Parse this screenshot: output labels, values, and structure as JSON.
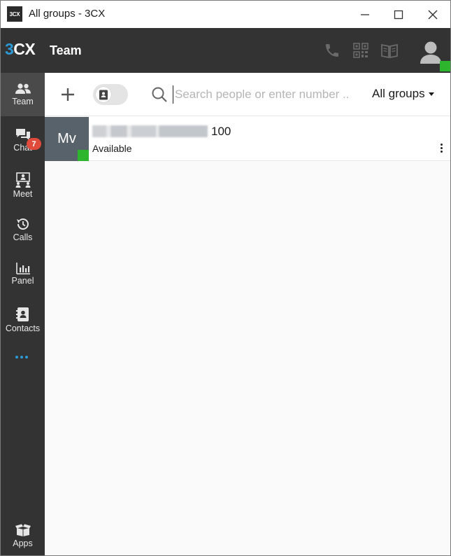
{
  "window": {
    "title": "All groups - 3CX",
    "icon_text": "3CX"
  },
  "header": {
    "logo_3": "3",
    "logo_cx": "CX",
    "title": "Team",
    "icons": [
      "phone-icon",
      "qr-code-icon",
      "book-icon",
      "user-avatar-icon"
    ],
    "status_color": "#2db52d"
  },
  "sidebar": {
    "items": [
      {
        "label": "Team",
        "icon": "team-icon",
        "active": true
      },
      {
        "label": "Chat",
        "icon": "chat-icon"
      },
      {
        "label": "Meet",
        "icon": "meet-icon"
      },
      {
        "label": "Calls",
        "icon": "calls-history-icon",
        "badge": "7"
      },
      {
        "label": "Panel",
        "icon": "panel-chart-icon"
      },
      {
        "label": "Contacts",
        "icon": "contacts-icon"
      },
      {
        "label": "Apps",
        "icon": "apps-box-icon"
      }
    ],
    "more_icon": "more-dots-icon"
  },
  "toolbar": {
    "search_placeholder": "Search people or enter number ..",
    "group_filter": "All groups"
  },
  "contacts": [
    {
      "initials": "Mv",
      "extension": "100",
      "presence": "Available",
      "status_color": "#2db52d"
    }
  ],
  "colors": {
    "accent": "#2c9ad6",
    "dark_bg": "#333333",
    "active_nav": "#4a4a4a",
    "badge": "#e14b3b",
    "available": "#2db52d"
  }
}
